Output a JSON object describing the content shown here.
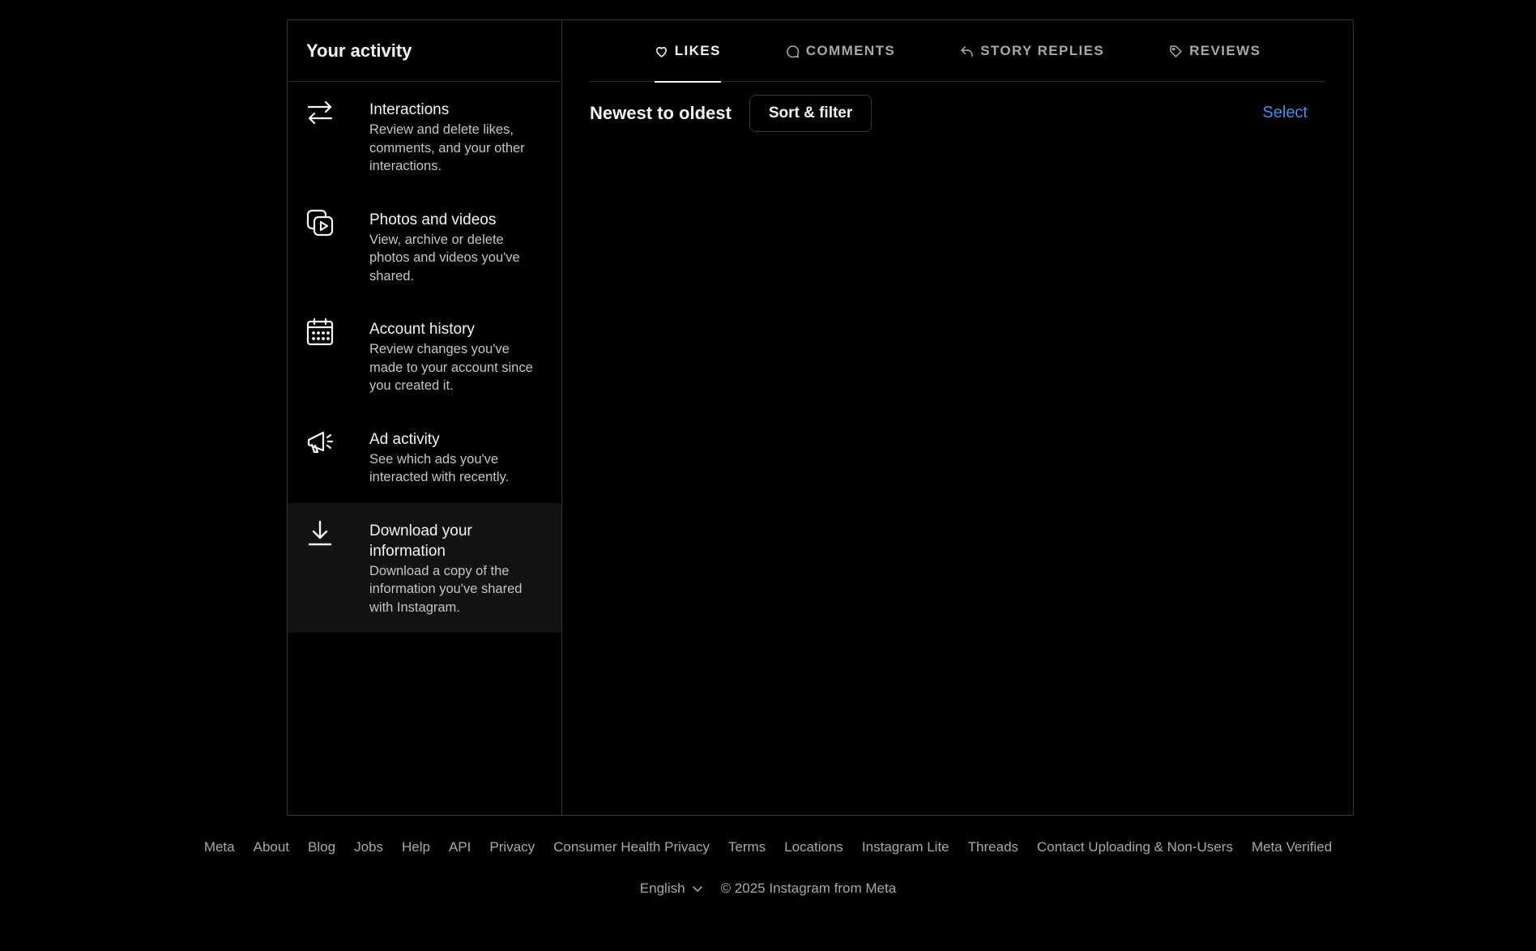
{
  "sidebar": {
    "title": "Your activity",
    "items": [
      {
        "title": "Interactions",
        "desc": "Review and delete likes, comments, and your other interactions.",
        "icon": "interactions-icon"
      },
      {
        "title": "Photos and videos",
        "desc": "View, archive or delete photos and videos you've shared.",
        "icon": "photos-videos-icon"
      },
      {
        "title": "Account history",
        "desc": "Review changes you've made to your account since you created it.",
        "icon": "calendar-icon"
      },
      {
        "title": "Ad activity",
        "desc": "See which ads you've interacted with recently.",
        "icon": "megaphone-icon"
      },
      {
        "title": "Download your information",
        "desc": "Download a copy of the information you've shared with Instagram.",
        "icon": "download-icon"
      }
    ]
  },
  "tabs": [
    {
      "label": "LIKES",
      "icon": "heart-icon",
      "active": true
    },
    {
      "label": "COMMENTS",
      "icon": "comment-icon",
      "active": false
    },
    {
      "label": "STORY REPLIES",
      "icon": "reply-icon",
      "active": false
    },
    {
      "label": "REVIEWS",
      "icon": "tag-icon",
      "active": false
    }
  ],
  "toolbar": {
    "sort_label": "Newest to oldest",
    "sort_button": "Sort & filter",
    "select_label": "Select"
  },
  "grid_colors": [
    "#5a6f86",
    "#7a5a5e",
    "#6c6a60",
    "#6f8fb0",
    "#9b8c86",
    "#7d8fa8",
    "#4a3a36",
    "#6e6870",
    "#7f8a5a",
    "#b7b99a",
    "#4f6fa8",
    "#c9c9c9",
    "#7a8a6a",
    "#8f9a70",
    "#8a7a6e",
    "#3a2a6a",
    "#b39a82",
    "#7a7a7a",
    "#a6823e",
    "#8f9d62",
    "#e6e6e6",
    "#5f5f66",
    "#6a4aa0",
    "#8fa3bb",
    "#6a5a56"
  ],
  "accent_color": "#3d8ff0",
  "footer": {
    "links": [
      "Meta",
      "About",
      "Blog",
      "Jobs",
      "Help",
      "API",
      "Privacy",
      "Consumer Health Privacy",
      "Terms",
      "Locations",
      "Instagram Lite",
      "Threads",
      "Contact Uploading & Non-Users",
      "Meta Verified"
    ],
    "language": "English",
    "copyright": "© 2025 Instagram from Meta"
  }
}
